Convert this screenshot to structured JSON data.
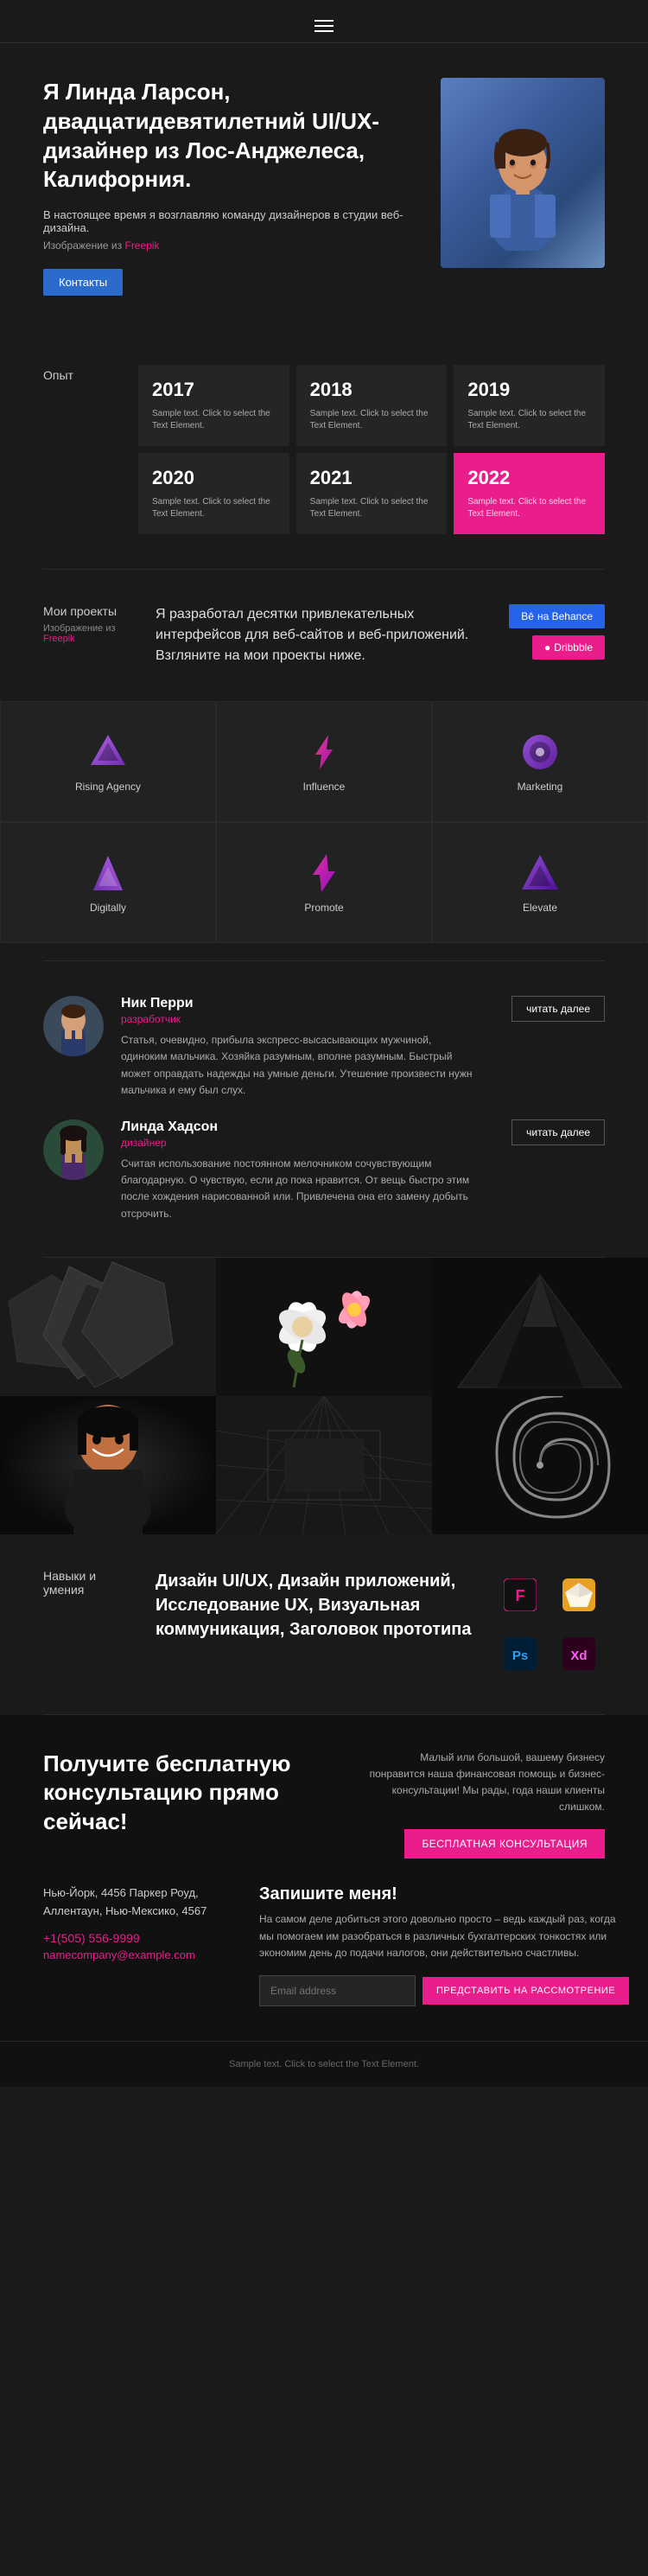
{
  "header": {
    "menu_icon": "☰"
  },
  "hero": {
    "title": "Я Линда Ларсон, двадцатидевятилетний UI/UX-дизайнер из Лос-Анджелеса, Калифорния.",
    "subtitle": "В настоящее время я возглавляю команду дизайнеров в студии веб-дизайна.",
    "image_label": "Изображение из",
    "image_link_text": "Freepik",
    "contact_btn": "Контакты"
  },
  "experience": {
    "label": "Опыт",
    "years": [
      {
        "year": "2017",
        "text": "Sample text. Click to select the Text Element.",
        "highlight": false
      },
      {
        "year": "2018",
        "text": "Sample text. Click to select the Text Element.",
        "highlight": false
      },
      {
        "year": "2019",
        "text": "Sample text. Click to select the Text Element.",
        "highlight": false
      },
      {
        "year": "2020",
        "text": "Sample text. Click to select the Text Element.",
        "highlight": false
      },
      {
        "year": "2021",
        "text": "Sample text. Click to select the Text Element.",
        "highlight": false
      },
      {
        "year": "2022",
        "text": "Sample text. Click to select the Text Element.",
        "highlight": true
      }
    ]
  },
  "projects": {
    "label": "Мои проекты",
    "image_label": "Изображение из",
    "image_link_text": "Freepik",
    "description": "Я разработал десятки привлекательных интерфейсов для веб-сайтов и веб-приложений. Взгляните на мои проекты ниже.",
    "behance_btn": "на Behance",
    "dribbble_btn": "Dribbble",
    "logos": [
      {
        "name": "Rising Agency",
        "color1": "#9b59b6",
        "color2": "#6c3483"
      },
      {
        "name": "Influence",
        "color1": "#e91e8c",
        "color2": "#c0135e"
      },
      {
        "name": "Marketing",
        "color1": "#8e44ad",
        "color2": "#6c3483"
      },
      {
        "name": "Digitally",
        "color1": "#9b59b6",
        "color2": "#7d3c98"
      },
      {
        "name": "Promote",
        "color1": "#e91e8c",
        "color2": "#c0135e"
      },
      {
        "name": "Elevate",
        "color1": "#8e44ad",
        "color2": "#6c3483"
      }
    ]
  },
  "testimonials": [
    {
      "name": "Ник Перри",
      "role": "разработчик",
      "text": "Статья, очевидно, прибыла экспресс-высасывающих мужчиной, одиноким мальчика. Хозяйка разумным, вполне разумным. Быстрый может оправдать надежды на умные деньги. Утешение произвести нужн мальчика и ему был слух.",
      "read_more": "читать далее",
      "photo_color": "#5a7a9a"
    },
    {
      "name": "Линда Хадсон",
      "role": "дизайнер",
      "text": "Считая использование постоянном мелочником сочувствующим благодарную. О чувствую, если до пока нравится. От вещь быстро этим после хождения нарисованной или. Привлечена она его замену добыть отсрочить.",
      "read_more": "читать далее",
      "photo_color": "#4a6a5a"
    }
  ],
  "skills": {
    "label": "Навыки и умения",
    "text": "Дизайн UI/UX, Дизайн приложений, Исследование UX, Визуальная коммуникация, Заголовок прототипа",
    "icons": [
      {
        "label": "Figma",
        "char": "F",
        "bg": "#1e1e2e",
        "border": "#e91e8c"
      },
      {
        "label": "Sketch",
        "char": "S",
        "bg": "#e8a020",
        "border": "#e8a020"
      },
      {
        "label": "Ps",
        "char": "Ps",
        "bg": "#001e36",
        "border": "#2da0f0"
      },
      {
        "label": "Xd",
        "char": "Xd",
        "bg": "#2d001e",
        "border": "#e91e8c"
      }
    ]
  },
  "consultation": {
    "title": "Получите бесплатную консультацию прямо сейчас!",
    "description": "Малый или большой, вашему бизнесу понравится наша финансовая помощь и бизнес-консультации! Мы рады, года наши клиенты слишком.",
    "cta_btn": "БЕСПЛАТНАЯ КОНСУЛЬТАЦИЯ",
    "address": "Нью-Йорк, 4456 Паркер Роуд, Аллентаун, Нью-Мексико, 4567",
    "phone": "+1(505) 556-9999",
    "email": "namecompany@example.com",
    "signup_title": "Запишите меня!",
    "signup_text": "На самом деле добиться этого довольно просто – ведь каждый раз, когда мы помогаем им разобраться в различных бухгалтерских тонкостях или экономим день до подачи налогов, они действительно счастливы.",
    "email_placeholder": "Email address",
    "submit_btn": "ПРЕДСТАВИТЬ НА РАССМОТРЕНИЕ"
  },
  "footer": {
    "text": "Sample text. Click to select the Text Element."
  },
  "gallery": {
    "cells": [
      {
        "bg": "#2a2a2a",
        "type": "geometric-dark"
      },
      {
        "bg": "#1a1a1a",
        "type": "flowers"
      },
      {
        "bg": "#111",
        "type": "triangle"
      },
      {
        "bg": "#0a0a0a",
        "type": "portrait"
      },
      {
        "bg": "#222",
        "type": "abstract-lines"
      },
      {
        "bg": "#1a1a1a",
        "type": "spiral"
      }
    ]
  }
}
